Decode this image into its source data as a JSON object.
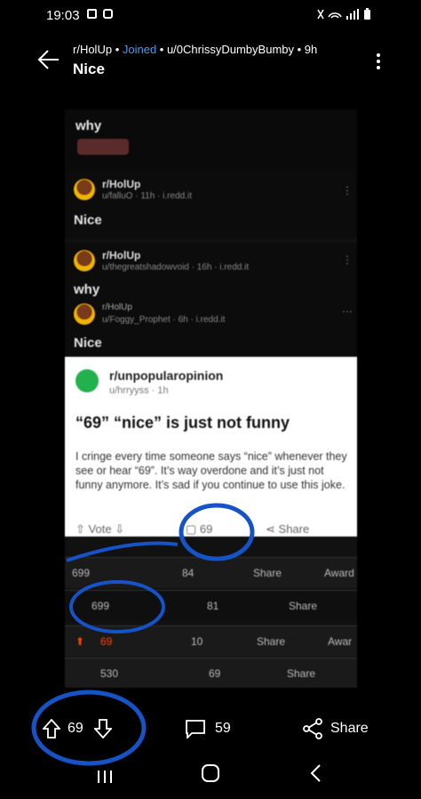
{
  "status_bar": {
    "time": "19:03"
  },
  "header": {
    "subreddit": "r/HolUp",
    "joined": "Joined",
    "user": "u/0ChrissyDumbyBumby",
    "age": "9h",
    "title": "Nice"
  },
  "embedded": {
    "top_title": "why",
    "post1": {
      "sub": "r/HolUp",
      "meta": "u/falluO · 11h · i.redd.it",
      "title": "Nice"
    },
    "post2": {
      "sub": "r/HolUp",
      "meta": "u/thegreatshadowvoid · 16h · i.redd.it",
      "title": "why"
    },
    "post3": {
      "sub": "r/HolUp",
      "meta": "u/Foggy_Prophet · 6h · i.redd.it",
      "title": "Nice"
    },
    "white_post": {
      "sub": "r/unpopularopinion",
      "meta": "u/hrryyss · 1h",
      "title": "“69” “nice” is just not funny",
      "body": "I cringe every time someone says “nice” whenever they see or hear “69”. It’s way overdone and it’s just not funny anymore. It’s sad if you continue to use this joke.",
      "vote_label": "Vote",
      "comments": "69",
      "share": "Share"
    },
    "bars": [
      {
        "votes": "699",
        "comments": "84",
        "share": "Share",
        "award": "Award"
      },
      {
        "votes": "699",
        "comments": "81",
        "share": "Share"
      },
      {
        "votes": "69",
        "comments": "10",
        "share": "Share",
        "award": "Awar"
      },
      {
        "votes": "530",
        "comments": "69",
        "share": "Share"
      }
    ]
  },
  "action_bar": {
    "votes": "69",
    "comments": "59",
    "share": "Share"
  },
  "colors": {
    "joined": "#4a9ae8",
    "upvote_active": "#ff4500",
    "scribble": "#1553c7"
  }
}
